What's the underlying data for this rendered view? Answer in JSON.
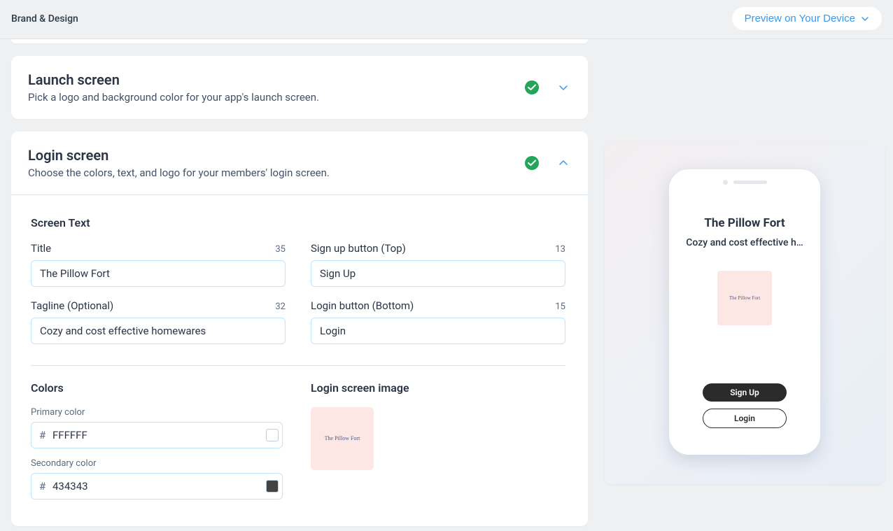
{
  "header": {
    "title": "Brand & Design",
    "preview_label": "Preview on Your Device"
  },
  "launch_card": {
    "title": "Launch screen",
    "subtitle": "Pick a logo and background color for your app's launch screen."
  },
  "login_card": {
    "title": "Login screen",
    "subtitle": "Choose the colors, text, and logo for your members' login screen.",
    "screen_text_section": "Screen Text",
    "fields": {
      "title": {
        "label": "Title",
        "counter": "35",
        "value": "The Pillow Fort"
      },
      "signup": {
        "label": "Sign up button (Top)",
        "counter": "13",
        "value": "Sign Up"
      },
      "tagline": {
        "label": "Tagline (Optional)",
        "counter": "32",
        "value": "Cozy and cost effective homewares"
      },
      "login": {
        "label": "Login button (Bottom)",
        "counter": "15",
        "value": "Login"
      }
    },
    "colors_section": "Colors",
    "colors": {
      "primary": {
        "label": "Primary color",
        "value": "FFFFFF",
        "hex": "#FFFFFF"
      },
      "secondary": {
        "label": "Secondary color",
        "value": "434343",
        "hex": "#434343"
      }
    },
    "image_section": "Login screen image",
    "logo_text": "The Pillow Fort"
  },
  "preview": {
    "title": "The Pillow Fort",
    "tagline": "Cozy and cost effective h…",
    "logo_text": "The Pillow Fort",
    "signup_btn": "Sign Up",
    "login_btn": "Login"
  }
}
